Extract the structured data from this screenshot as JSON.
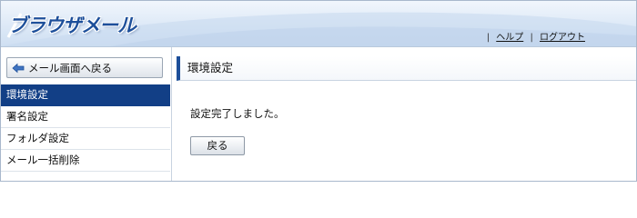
{
  "app": {
    "logo_text": "ブラウザメール"
  },
  "header": {
    "links": [
      {
        "label": "ヘルプ"
      },
      {
        "label": "ログアウト"
      }
    ]
  },
  "sidebar": {
    "back_button_label": "メール画面へ戻る",
    "items": [
      {
        "label": "環境設定",
        "active": true
      },
      {
        "label": "署名設定",
        "active": false
      },
      {
        "label": "フォルダ設定",
        "active": false
      },
      {
        "label": "メール一括削除",
        "active": false
      }
    ]
  },
  "main": {
    "title": "環境設定",
    "message": "設定完了しました。",
    "return_button_label": "戻る"
  },
  "colors": {
    "accent": "#123f86",
    "header_bg": "#dde9f7",
    "logo": "#1d4f9a"
  }
}
